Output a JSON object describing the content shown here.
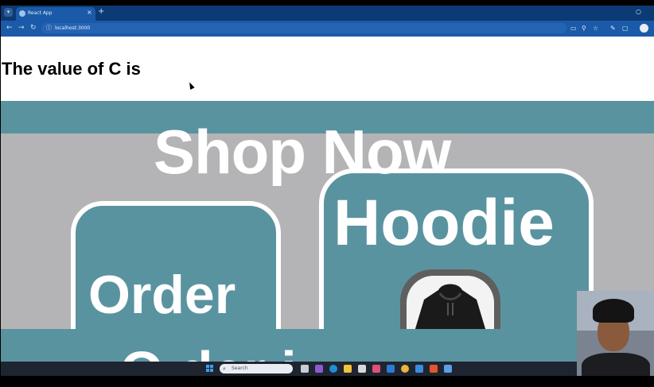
{
  "browser": {
    "tab_title": "React App",
    "tab_close": "×",
    "new_tab": "+",
    "url": "localhost:3000"
  },
  "page": {
    "heading": "The value of C is",
    "banner": {
      "shop_text": "Shop Now",
      "order_text": "Order",
      "hoodie_text": "Hoodie",
      "bottom_text": "O  der  i"
    }
  },
  "taskbar": {
    "search_placeholder": "Search"
  },
  "colors": {
    "tab_strip": "#0b3a74",
    "toolbar": "#1b5aa8",
    "banner_teal": "#5a93a0",
    "banner_gray": "#b4b4b6"
  },
  "icons": [
    "tab-list-icon",
    "favicon-icon",
    "close-icon",
    "plus-icon",
    "back-icon",
    "forward-icon",
    "reload-icon",
    "info-icon",
    "cast-icon",
    "zoom-icon",
    "star-icon",
    "pen-icon",
    "extensions-icon",
    "profile-icon",
    "windows-start-icon",
    "search-icon"
  ]
}
